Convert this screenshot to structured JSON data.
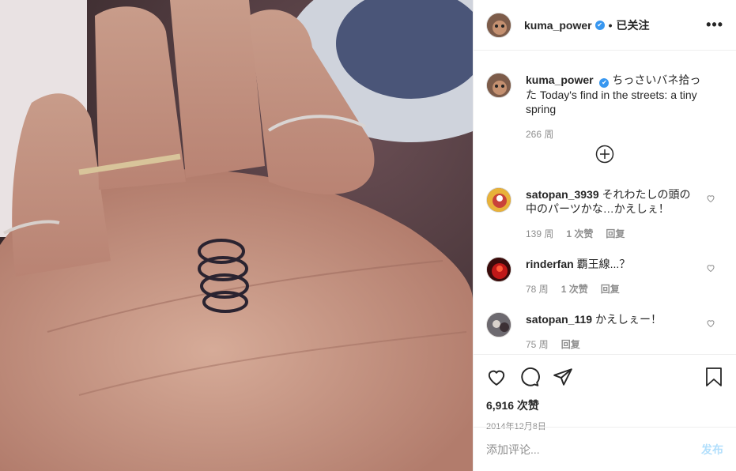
{
  "post": {
    "username": "kuma_power",
    "verified_mark": "✔",
    "separator": "•",
    "follow_label": "已关注",
    "more_label": "•••"
  },
  "caption": {
    "username": "kuma_power",
    "text": "ちっさいバネ拾った Today's find in the streets: a tiny spring",
    "time": "266 周"
  },
  "comments": [
    {
      "username": "satopan_3939",
      "text": "それわたしの頭の中のパーツかな…かえしぇ！",
      "time": "139 周",
      "likes": "1 次赞",
      "reply": "回复"
    },
    {
      "username": "rinderfan",
      "text": "覇王線...？",
      "time": "78 周",
      "likes": "1 次赞",
      "reply": "回复"
    },
    {
      "username": "satopan_119",
      "text": "かえしぇー！",
      "time": "75 周",
      "likes": "",
      "reply": "回复"
    }
  ],
  "stats": {
    "likes": "6,916 次赞",
    "date": "2014年12月8日"
  },
  "add_comment": {
    "placeholder": "添加评论...",
    "post_label": "发布"
  },
  "icons": {
    "like": "heart-icon",
    "comment": "comment-icon",
    "share": "send-icon",
    "save": "bookmark-icon",
    "load_more": "plus-circle-icon"
  },
  "colors": {
    "verified": "#3897f0",
    "post_button": "#b2dffc",
    "muted": "#8e8e8e"
  }
}
